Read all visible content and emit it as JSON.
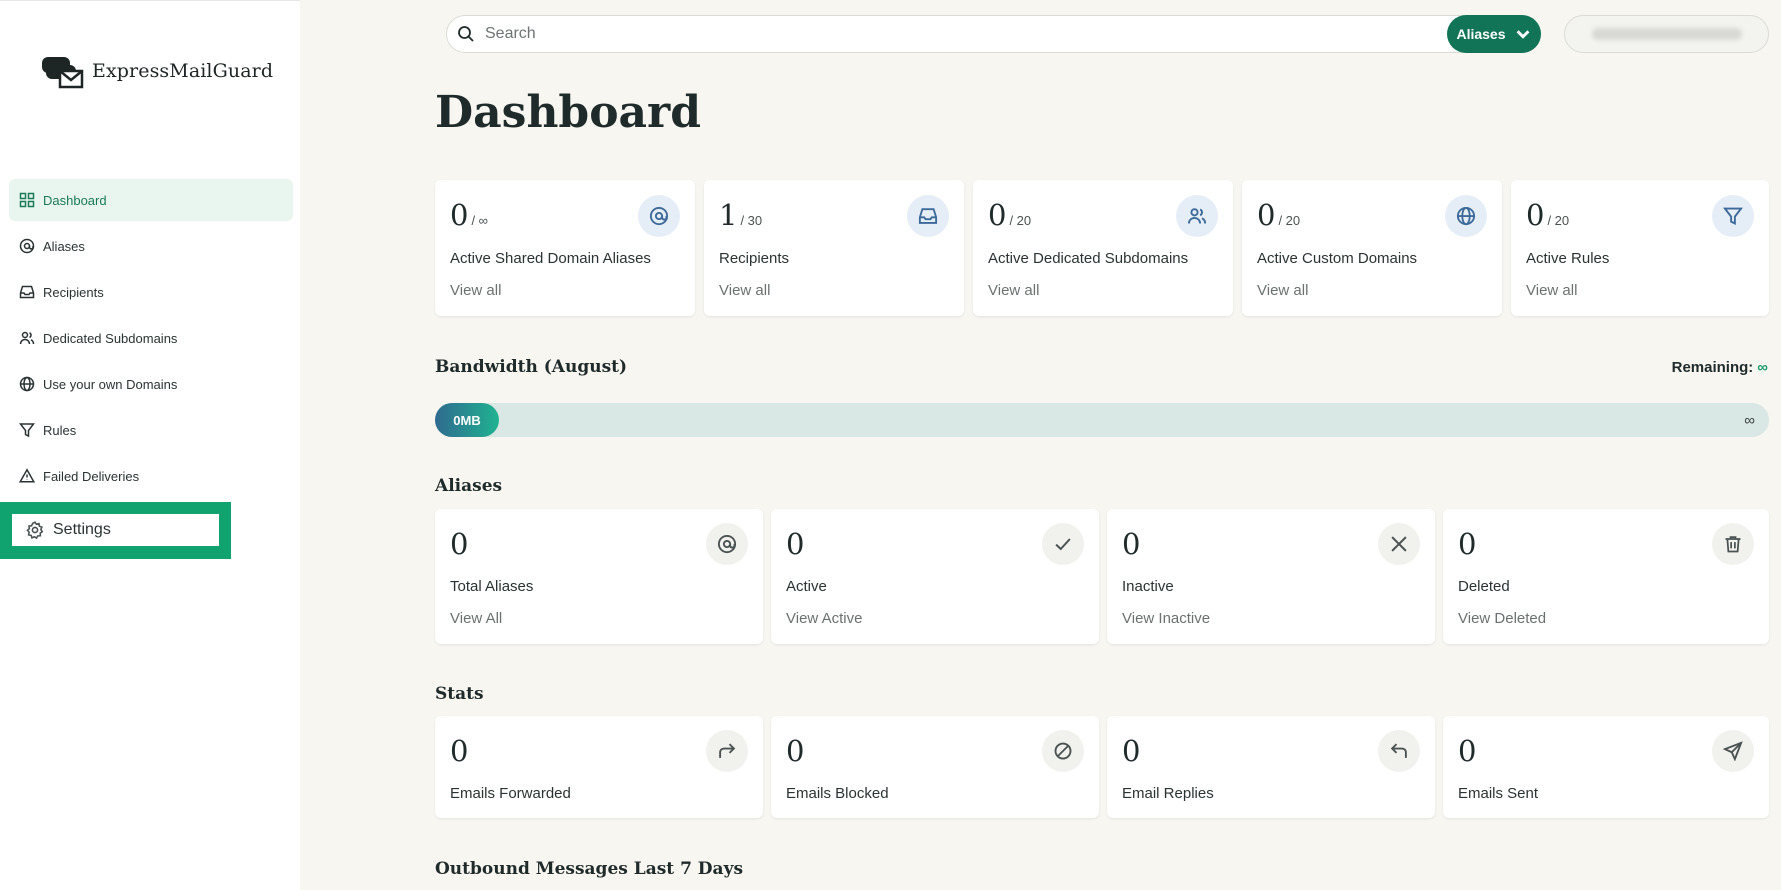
{
  "brand": {
    "name": "ExpressMailGuard"
  },
  "sidebar": {
    "items": [
      {
        "label": "Dashboard",
        "icon": "grid-icon",
        "active": true
      },
      {
        "label": "Aliases",
        "icon": "at-icon"
      },
      {
        "label": "Recipients",
        "icon": "inbox-icon"
      },
      {
        "label": "Dedicated Subdomains",
        "icon": "users-icon"
      },
      {
        "label": "Use your own Domains",
        "icon": "globe-icon"
      },
      {
        "label": "Rules",
        "icon": "filter-icon"
      },
      {
        "label": "Failed Deliveries",
        "icon": "warning-icon"
      }
    ],
    "settings_label": "Settings"
  },
  "search": {
    "placeholder": "Search",
    "scope_label": "Aliases"
  },
  "page": {
    "title": "Dashboard"
  },
  "summary_cards": [
    {
      "value": "0",
      "limit": "/ ∞",
      "label": "Active Shared Domain Aliases",
      "link": "View all",
      "icon": "at-icon"
    },
    {
      "value": "1",
      "limit": "/ 30",
      "label": "Recipients",
      "link": "View all",
      "icon": "inbox-icon"
    },
    {
      "value": "0",
      "limit": "/ 20",
      "label": "Active Dedicated Subdomains",
      "link": "View all",
      "icon": "users-icon"
    },
    {
      "value": "0",
      "limit": "/ 20",
      "label": "Active Custom Domains",
      "link": "View all",
      "icon": "globe-icon"
    },
    {
      "value": "0",
      "limit": "/ 20",
      "label": "Active Rules",
      "link": "View all",
      "icon": "filter-icon"
    }
  ],
  "bandwidth": {
    "title": "Bandwidth (August)",
    "remaining_label": "Remaining:",
    "remaining_value": "∞",
    "used_label": "0MB",
    "max_label": "∞",
    "used_fraction": 0
  },
  "aliases_section": {
    "title": "Aliases",
    "cards": [
      {
        "value": "0",
        "label": "Total Aliases",
        "link": "View All",
        "icon": "at-icon"
      },
      {
        "value": "0",
        "label": "Active",
        "link": "View Active",
        "icon": "check-icon"
      },
      {
        "value": "0",
        "label": "Inactive",
        "link": "View Inactive",
        "icon": "x-icon"
      },
      {
        "value": "0",
        "label": "Deleted",
        "link": "View Deleted",
        "icon": "trash-icon"
      }
    ]
  },
  "stats_section": {
    "title": "Stats",
    "cards": [
      {
        "value": "0",
        "label": "Emails Forwarded",
        "icon": "forward-icon"
      },
      {
        "value": "0",
        "label": "Emails Blocked",
        "icon": "blocked-icon"
      },
      {
        "value": "0",
        "label": "Email Replies",
        "icon": "reply-icon"
      },
      {
        "value": "0",
        "label": "Emails Sent",
        "icon": "send-icon"
      }
    ]
  },
  "outbound_section": {
    "title": "Outbound Messages Last 7 Days"
  },
  "colors": {
    "brand_green": "#127456",
    "highlight_frame": "#10a370",
    "accent_infinity": "#1a9a6c"
  }
}
